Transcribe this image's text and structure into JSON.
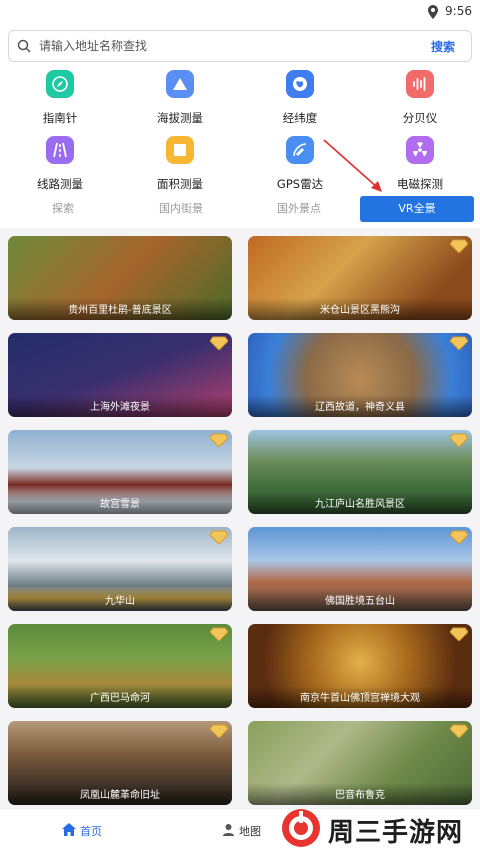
{
  "status": {
    "time": "9:56"
  },
  "search": {
    "placeholder": "请输入地址名称查找",
    "button": "搜索"
  },
  "tools": [
    {
      "label": "指南针",
      "icon": "compass-icon",
      "color": "#1fc9a3"
    },
    {
      "label": "海拔测量",
      "icon": "mountain-icon",
      "color": "#5b8ef5"
    },
    {
      "label": "经纬度",
      "icon": "globe-icon",
      "color": "#3f7cf0"
    },
    {
      "label": "分贝仪",
      "icon": "sound-wave-icon",
      "color": "#f26b6b"
    },
    {
      "label": "线路测量",
      "icon": "road-icon",
      "color": "#9a6df0"
    },
    {
      "label": "面积测量",
      "icon": "area-icon",
      "color": "#f7b733"
    },
    {
      "label": "GPS雷达",
      "icon": "satellite-icon",
      "color": "#4a8ef2"
    },
    {
      "label": "电磁探测",
      "icon": "radiation-icon",
      "color": "#b26cf0"
    }
  ],
  "tabs": [
    "探索",
    "国内街景",
    "国外景点",
    "VR全景"
  ],
  "active_tab": "VR全景",
  "cards": [
    {
      "title": "贵州百里杜鹃-普底景区",
      "premium": false
    },
    {
      "title": "米仓山景区黑熊沟",
      "premium": true
    },
    {
      "title": "上海外滩夜景",
      "premium": true
    },
    {
      "title": "辽西故道，神奇义县",
      "premium": true
    },
    {
      "title": "故宫雪景",
      "premium": true
    },
    {
      "title": "九江庐山名胜风景区",
      "premium": true
    },
    {
      "title": "九华山",
      "premium": true
    },
    {
      "title": "佛国胜境五台山",
      "premium": true
    },
    {
      "title": "广西巴马命河",
      "premium": true
    },
    {
      "title": "南京牛首山佛顶宫禅境大观",
      "premium": true
    },
    {
      "title": "凤凰山麓革命旧址",
      "premium": true
    },
    {
      "title": "巴音布鲁克",
      "premium": true
    }
  ],
  "nav": {
    "home": "首页",
    "map": "地图"
  },
  "watermark": "周三手游网"
}
